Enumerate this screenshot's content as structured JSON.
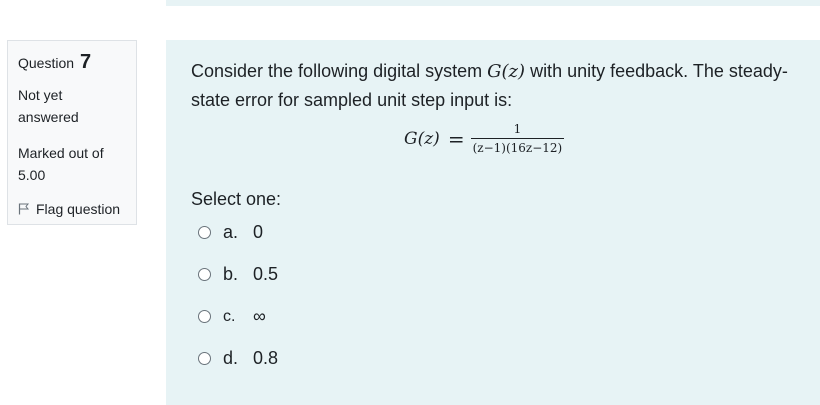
{
  "question_info": {
    "label": "Question",
    "number": "7",
    "state": "Not yet answered",
    "grade": "Marked out of 5.00",
    "flag_label": "Flag question",
    "flag_icon": "flag-outline-icon"
  },
  "question": {
    "text_part1": "Consider the following digital system ",
    "text_var": "G(z)",
    "text_part2": " with unity feedback. The steady-state error for sampled unit step input is:",
    "equation": {
      "lhs": "G(z)",
      "equals": "=",
      "numerator": "1",
      "denominator": "(z−1)(16z−12)"
    },
    "prompt": "Select one:",
    "options": [
      {
        "letter": "a.",
        "value": "0"
      },
      {
        "letter": "b.",
        "value": "0.5"
      },
      {
        "letter": "c.",
        "value": "∞"
      },
      {
        "letter": "d.",
        "value": "0.8"
      }
    ]
  },
  "colors": {
    "content_bg": "#e7f3f5",
    "info_bg": "#f8f9fa",
    "text": "#1d2125"
  }
}
